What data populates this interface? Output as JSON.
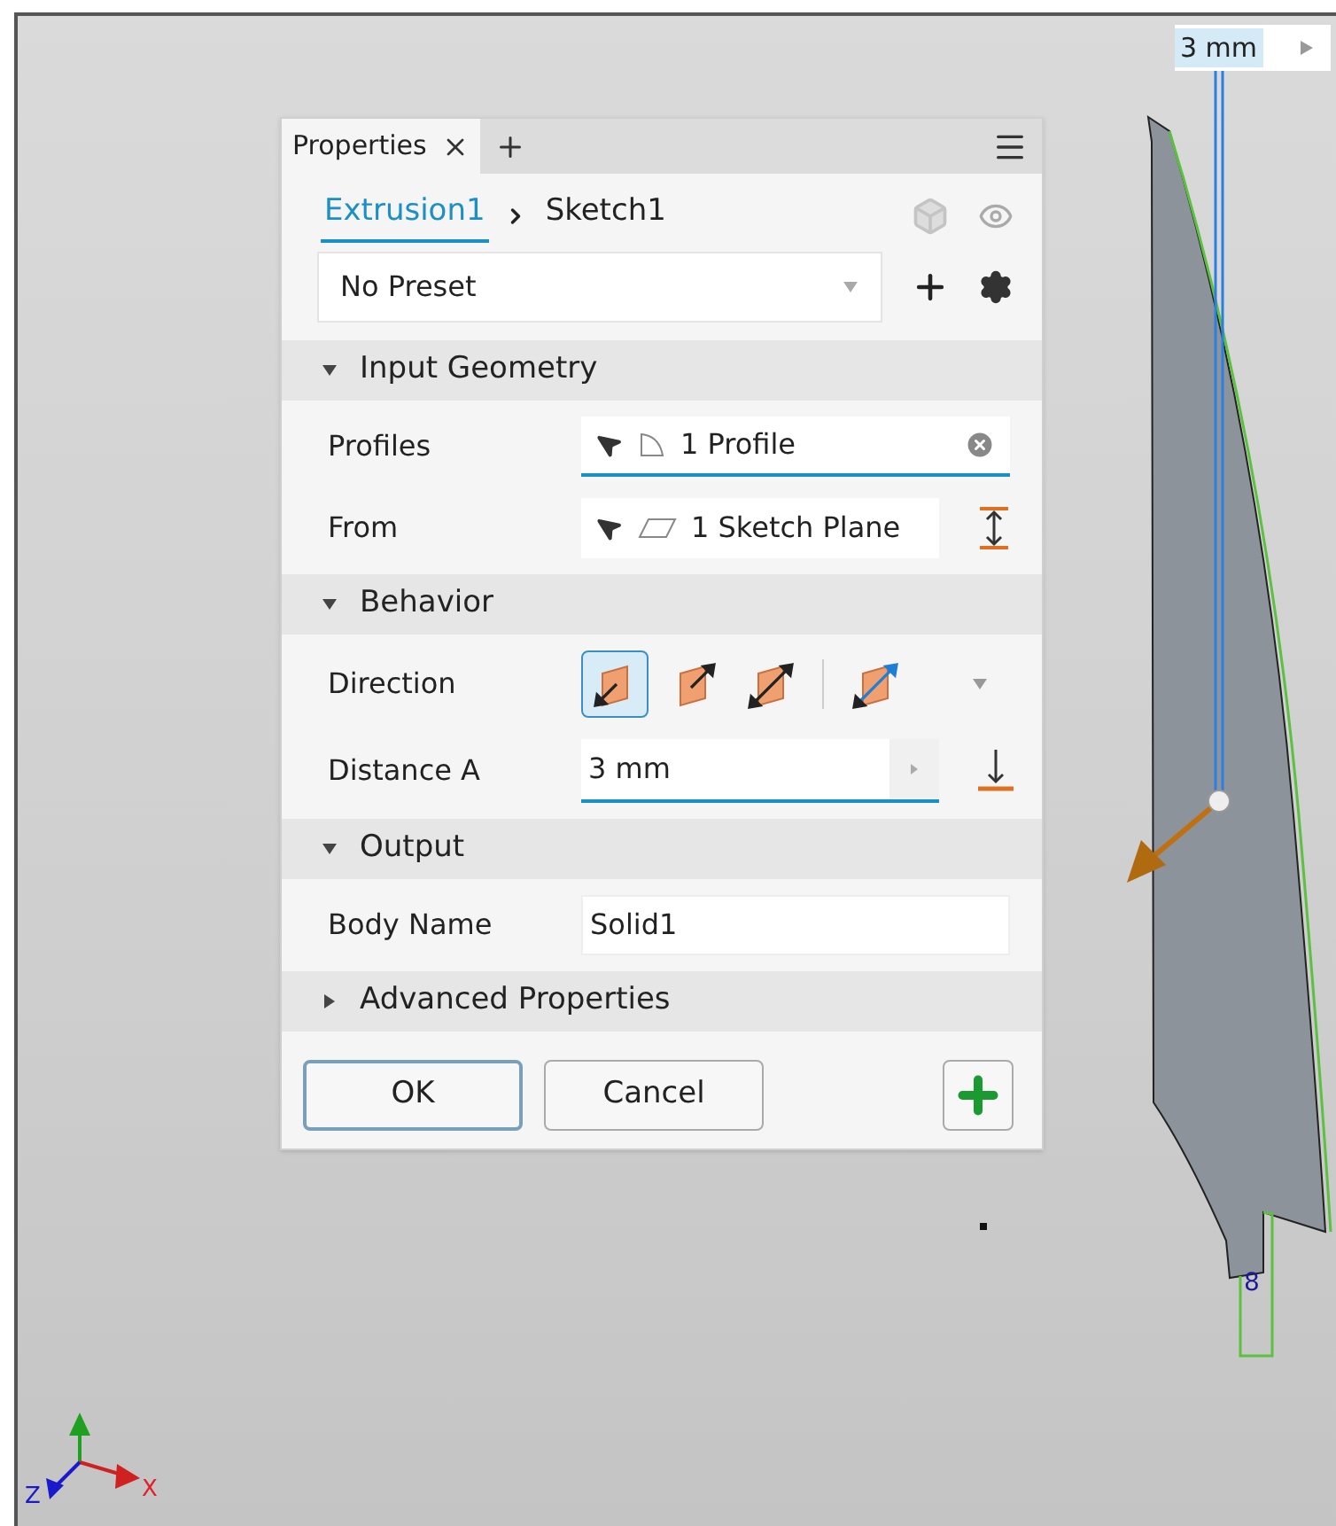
{
  "viewport": {
    "dimension_input": {
      "value": "3 mm"
    },
    "sketch_dimension": "8",
    "axes": [
      {
        "label": "Z",
        "color": "#1a1acc"
      },
      {
        "label": "X",
        "color": "#e0202a"
      }
    ]
  },
  "panel": {
    "tabs": [
      {
        "label": "Properties",
        "selected": true
      }
    ],
    "breadcrumb": [
      {
        "label": "Extrusion1",
        "selected": true
      },
      {
        "label": "Sketch1",
        "selected": false
      }
    ],
    "preset": {
      "value": "No Preset"
    },
    "sections": [
      {
        "title": "Input Geometry",
        "expanded": true,
        "rows": [
          {
            "kind": "selection",
            "label": "Profiles",
            "value": "1 Profile",
            "icon": {
              "kind": "profile"
            },
            "focused": true
          },
          {
            "kind": "selection",
            "label": "From",
            "value": "1 Sketch Plane",
            "icon": {
              "kind": "plane"
            },
            "focused": false
          }
        ]
      },
      {
        "title": "Behavior",
        "expanded": true,
        "rows": [
          {
            "kind": "direction",
            "label": "Direction",
            "options": [
              {
                "selected": true
              },
              {
                "selected": false
              },
              {
                "selected": false
              },
              {
                "selected": false
              }
            ]
          },
          {
            "kind": "number",
            "label": "Distance A",
            "value": "3 mm",
            "focused": true
          }
        ]
      },
      {
        "title": "Output",
        "expanded": true,
        "rows": [
          {
            "kind": "text",
            "label": "Body Name",
            "value": "Solid1"
          }
        ]
      },
      {
        "title": "Advanced Properties",
        "expanded": false
      }
    ],
    "buttons": [
      {
        "label": "OK",
        "default": true
      },
      {
        "label": "Cancel",
        "default": false
      }
    ]
  }
}
